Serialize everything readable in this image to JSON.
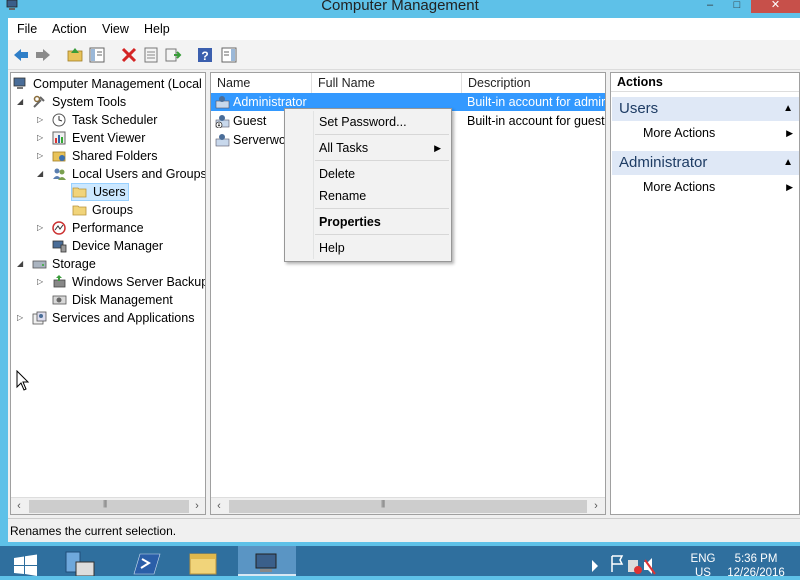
{
  "window": {
    "title": "Computer Management"
  },
  "caption_buttons": {
    "minimize": "–",
    "maximize": "□",
    "close": "✕"
  },
  "menubar": {
    "items": [
      "File",
      "Action",
      "View",
      "Help"
    ]
  },
  "toolbar": {
    "icons": [
      "back-arrow-icon",
      "forward-arrow-icon",
      "up-folder-icon",
      "show-hide-tree-icon",
      "delete-icon",
      "properties-icon",
      "export-list-icon",
      "help-icon",
      "show-hide-action-pane-icon"
    ]
  },
  "tree": {
    "root": "Computer Management (Local",
    "system_tools": "System Tools",
    "task_scheduler": "Task Scheduler",
    "event_viewer": "Event Viewer",
    "shared_folders": "Shared Folders",
    "local_users_groups": "Local Users and Groups",
    "users": "Users",
    "groups": "Groups",
    "performance": "Performance",
    "device_manager": "Device Manager",
    "storage": "Storage",
    "wsb": "Windows Server Backup",
    "disk_management": "Disk Management",
    "services_apps": "Services and Applications"
  },
  "list": {
    "columns": [
      "Name",
      "Full Name",
      "Description"
    ],
    "rows": [
      {
        "name": "Administrator",
        "full_name": "",
        "description": "Built-in account for admir"
      },
      {
        "name": "Guest",
        "full_name": "",
        "description": "Built-in account for guest"
      },
      {
        "name": "Serverworld",
        "full_name": "",
        "description": ""
      }
    ]
  },
  "actions": {
    "header": "Actions",
    "section1": "Users",
    "section1_item": "More Actions",
    "section2": "Administrator",
    "section2_item": "More Actions"
  },
  "context_menu": {
    "set_password": "Set Password...",
    "all_tasks": "All Tasks",
    "delete": "Delete",
    "rename": "Rename",
    "properties": "Properties",
    "help": "Help"
  },
  "status": {
    "text": "Renames the current selection."
  },
  "tray": {
    "lang1": "ENG",
    "lang2": "US",
    "time": "5:36 PM",
    "date": "12/26/2016"
  },
  "colors": {
    "selection": "#3399ff",
    "titlebar": "#5ec1e8",
    "taskbar": "#2f6f9e"
  }
}
